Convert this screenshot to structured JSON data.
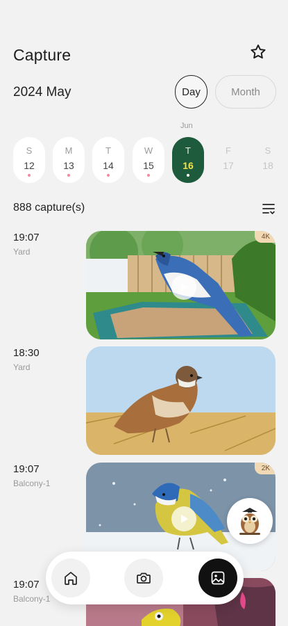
{
  "header": {
    "title": "Capture",
    "star_icon": "star-icon"
  },
  "period": {
    "label": "2024 May",
    "day_label": "Day",
    "month_label": "Month"
  },
  "calendar": {
    "next_month_label": "Jun",
    "days": [
      {
        "weekday": "S",
        "date": "12",
        "has_capture": true,
        "state": "normal"
      },
      {
        "weekday": "M",
        "date": "13",
        "has_capture": true,
        "state": "normal"
      },
      {
        "weekday": "T",
        "date": "14",
        "has_capture": true,
        "state": "normal"
      },
      {
        "weekday": "W",
        "date": "15",
        "has_capture": true,
        "state": "normal"
      },
      {
        "weekday": "T",
        "date": "16",
        "has_capture": true,
        "state": "selected"
      },
      {
        "weekday": "F",
        "date": "17",
        "has_capture": false,
        "state": "future"
      },
      {
        "weekday": "S",
        "date": "18",
        "has_capture": false,
        "state": "future"
      }
    ]
  },
  "captures": {
    "count_label": "888 capture(s)",
    "sort_icon": "sort-list-icon",
    "items": [
      {
        "time": "19:07",
        "location": "Yard",
        "badge": "4K",
        "video": true
      },
      {
        "time": "18:30",
        "location": "Yard",
        "badge": "",
        "video": false
      },
      {
        "time": "19:07",
        "location": "Balcony-1",
        "badge": "2K",
        "video": true
      },
      {
        "time": "19:07",
        "location": "Balcony-1",
        "badge": "",
        "video": false
      }
    ]
  },
  "bottom_nav": {
    "items": [
      {
        "name": "home",
        "icon": "home-icon",
        "active": false
      },
      {
        "name": "camera",
        "icon": "camera-icon",
        "active": false
      },
      {
        "name": "gallery",
        "icon": "gallery-icon",
        "active": true
      }
    ]
  },
  "colors": {
    "selected_day_bg": "#1e5a3c",
    "selected_day_number": "#f0e24c",
    "capture_dot": "#f08aa0",
    "badge_bg": "#f2d9b6",
    "active_nav_bg": "#111111"
  }
}
